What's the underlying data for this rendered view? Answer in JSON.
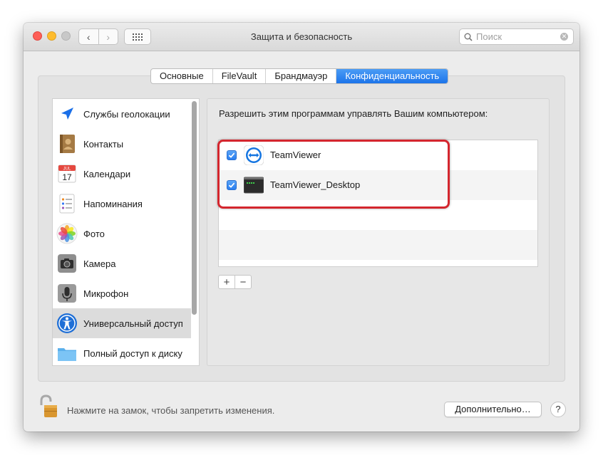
{
  "window": {
    "title": "Защита и безопасность",
    "search_placeholder": "Поиск",
    "nav_back": "‹",
    "nav_forward": "›"
  },
  "tabs": [
    {
      "label": "Основные",
      "active": false
    },
    {
      "label": "FileVault",
      "active": false
    },
    {
      "label": "Брандмауэр",
      "active": false
    },
    {
      "label": "Конфиденциальность",
      "active": true
    }
  ],
  "sidebar": {
    "items": [
      {
        "label": "Службы геолокации",
        "icon": "location-icon"
      },
      {
        "label": "Контакты",
        "icon": "contacts-icon"
      },
      {
        "label": "Календари",
        "icon": "calendar-icon",
        "calendar_month": "JUL",
        "calendar_day": "17"
      },
      {
        "label": "Напоминания",
        "icon": "reminders-icon"
      },
      {
        "label": "Фото",
        "icon": "photos-icon"
      },
      {
        "label": "Камера",
        "icon": "camera-icon"
      },
      {
        "label": "Микрофон",
        "icon": "microphone-icon"
      },
      {
        "label": "Универсальный доступ",
        "icon": "accessibility-icon",
        "selected": true
      },
      {
        "label": "Полный доступ к диску",
        "icon": "folder-icon"
      }
    ]
  },
  "main": {
    "heading": "Разрешить этим программам управлять Вашим компьютером:",
    "apps": [
      {
        "label": "TeamViewer",
        "checked": true,
        "icon": "teamviewer-icon"
      },
      {
        "label": "TeamViewer_Desktop",
        "checked": true,
        "icon": "terminal-exec-icon"
      }
    ],
    "add_label": "+",
    "remove_label": "−"
  },
  "footer": {
    "lock_text": "Нажмите на замок, чтобы запретить изменения.",
    "advanced_label": "Дополнительно…",
    "help_label": "?"
  },
  "colors": {
    "accent": "#1c74ea",
    "highlight_border": "#d4262e"
  }
}
